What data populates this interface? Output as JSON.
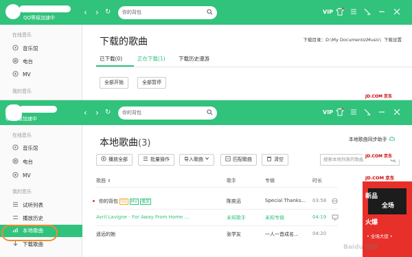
{
  "top_window": {
    "user_name": "QQ等级加速中",
    "search_placeholder": "你的背包",
    "vip_label": "VIP",
    "sidebar": {
      "online_header": "在线音乐",
      "items": [
        {
          "label": "音乐馆",
          "icon": "music-hall-icon"
        },
        {
          "label": "电台",
          "icon": "radio-icon"
        },
        {
          "label": "MV",
          "icon": "mv-icon"
        }
      ],
      "my_header": "我的音乐"
    },
    "title": "下载的歌曲",
    "download_dir": "下载目录：D:\\My Documents\\Music\\",
    "download_settings": "下载设置",
    "tabs": [
      {
        "label": "已下载(0)",
        "active": false
      },
      {
        "label": "正在下载(1)",
        "active": true
      },
      {
        "label": "下载历史漫游",
        "active": false
      }
    ],
    "buttons": {
      "start_all": "全部开始",
      "pause_all": "全部暂停"
    },
    "ad_header": "JD.COM 京东"
  },
  "bottom_window": {
    "user_name": "QQ等级加速中",
    "search_placeholder": "你的背包",
    "vip_label": "VIP",
    "sidebar": {
      "online_header": "在线音乐",
      "online_items": [
        {
          "label": "音乐馆",
          "icon": "music-hall-icon"
        },
        {
          "label": "电台",
          "icon": "radio-icon"
        },
        {
          "label": "MV",
          "icon": "mv-icon"
        }
      ],
      "my_header": "我的音乐",
      "my_items": [
        {
          "label": "试听列表",
          "icon": "list-icon"
        },
        {
          "label": "播放历史",
          "icon": "history-icon"
        },
        {
          "label": "本地歌曲",
          "icon": "local-icon",
          "active": true
        },
        {
          "label": "下载歌曲",
          "icon": "download-icon"
        }
      ]
    },
    "title": "本地歌曲",
    "title_count": "(3)",
    "sync_helper": "本地歌曲同步助手",
    "toolbar": {
      "play_all": "播放全部",
      "batch": "批量操作",
      "import": "导入歌曲",
      "match": "匹配歌曲",
      "clear": "清空"
    },
    "local_search_placeholder": "搜索本地列表的歌曲",
    "columns": {
      "song": "歌曲",
      "singer": "歌手",
      "album": "专辑",
      "duration": "时长"
    },
    "rows": [
      {
        "song": "你的背包",
        "tags": [
          "SQ",
          "MV",
          "播放"
        ],
        "singer": "陈奕迅",
        "album": "Special Thanks...",
        "duration": "03:58"
      },
      {
        "song": "Avril Lavigne - For Away From Home ...",
        "singer": "未知歌手",
        "album": "未知专辑",
        "duration": "04:19"
      },
      {
        "song": "遥远的她",
        "singer": "张学友",
        "album": "一人一首成名...",
        "duration": "04:20"
      }
    ],
    "ad": {
      "header": "JD.COM 京东",
      "line1": "新品",
      "line2": "全场",
      "line3": "火爆",
      "small": "• 全场大促 •"
    },
    "watermark": "Baidu 经验"
  },
  "colors": {
    "brand_green": "#31c27c",
    "ring_orange": "#f08c2e",
    "ad_red": "#e8302a"
  }
}
